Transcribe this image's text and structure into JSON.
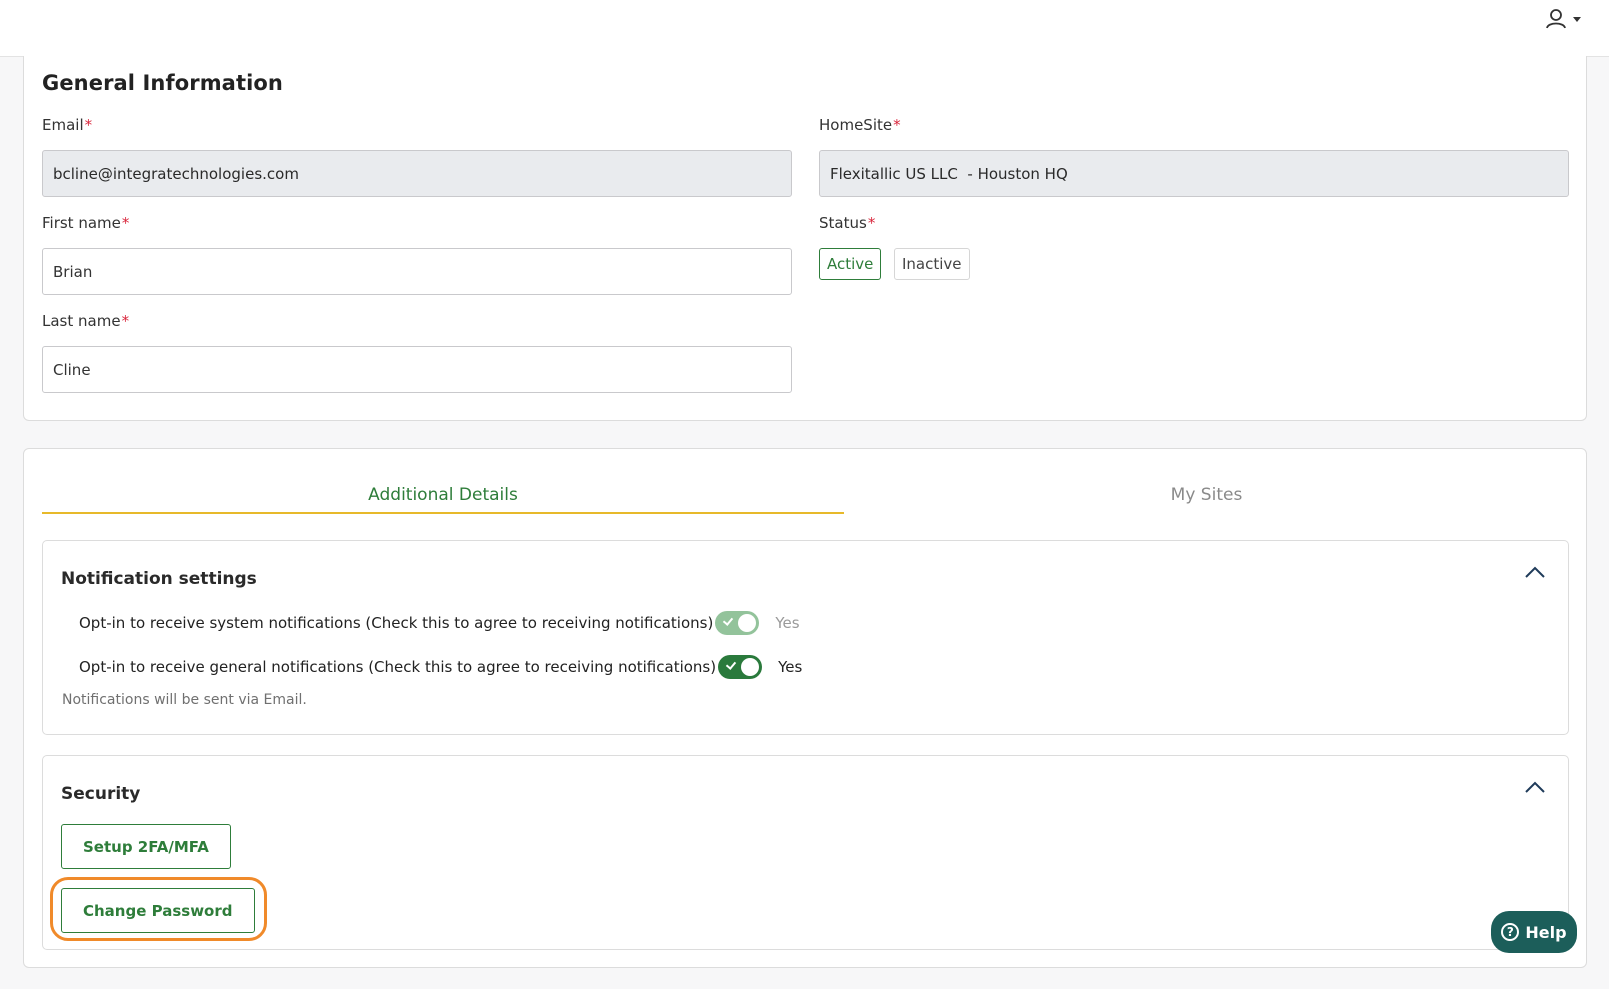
{
  "header": {
    "user_icon": "user-icon"
  },
  "general": {
    "title": "General Information",
    "email": {
      "label": "Email",
      "value": "bcline@integratechnologies.com"
    },
    "homesite": {
      "label": "HomeSite",
      "value": "Flexitallic US LLC  - Houston HQ"
    },
    "first_name": {
      "label": "First name",
      "value": "Brian"
    },
    "last_name": {
      "label": "Last name",
      "value": "Cline"
    },
    "status": {
      "label": "Status",
      "options": [
        "Active",
        "Inactive"
      ],
      "selected": "Active"
    },
    "required_marker": "*"
  },
  "tabs": [
    {
      "label": "Additional Details",
      "active": true
    },
    {
      "label": "My Sites",
      "active": false
    }
  ],
  "notifications": {
    "title": "Notification settings",
    "rows": [
      {
        "label": "Opt-in to receive system notifications (Check this to agree to receiving notifications)",
        "state": "Yes",
        "disabled": true
      },
      {
        "label": "Opt-in to receive general notifications (Check this to agree to receiving notifications)",
        "state": "Yes",
        "disabled": false
      }
    ],
    "note": "Notifications will be sent via Email."
  },
  "security": {
    "title": "Security",
    "setup_mfa_label": "Setup 2FA/MFA",
    "change_password_label": "Change Password"
  },
  "help": {
    "label": "Help",
    "icon_glyph": "?"
  },
  "colors": {
    "accent_green": "#2e7d3a",
    "tab_underline": "#e7b92a",
    "help_bg": "#1c5e5a",
    "highlight": "#f08a2a"
  }
}
